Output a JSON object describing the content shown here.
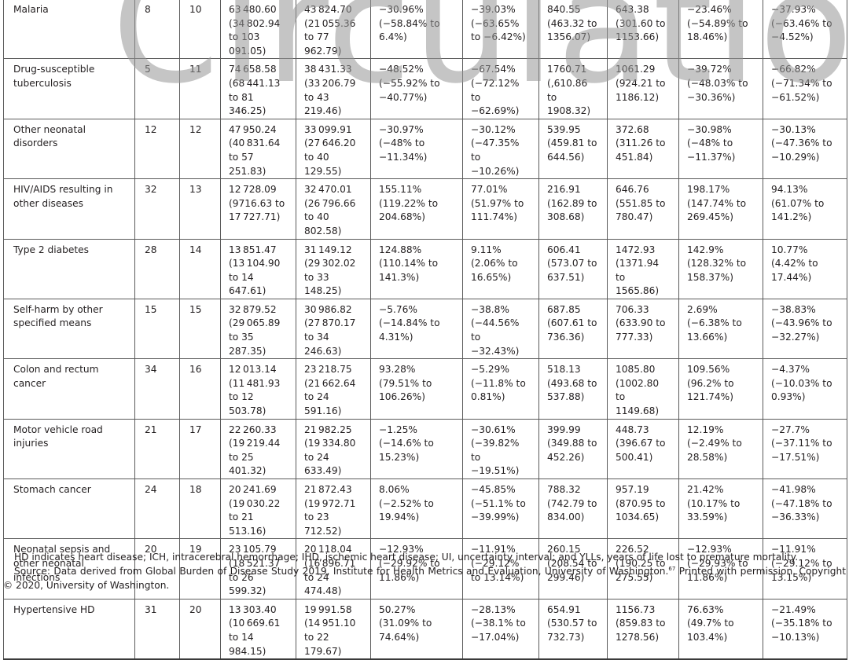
{
  "watermark": "Circulation",
  "table": {
    "rows": [
      {
        "cause": "Malaria",
        "rank_a": "8",
        "rank_b": "10",
        "c1": "63 480.60 (34 802.94 to 103 091.05)",
        "c2": "43 824.70 (21 055.36 to 77 962.79)",
        "c3": "−30.96% (−58.84% to 6.4%)",
        "c4": "−39.03% (−63.65% to −6.42%)",
        "c5": "840.55 (463.32 to 1356.07)",
        "c6": "643.38 (301.60 to 1153.66)",
        "c7": "−23.46% (−54.89% to 18.46%)",
        "c8": "−37.93% (−63.46% to −4.52%)"
      },
      {
        "cause": "Drug-susceptible tuberculosis",
        "rank_a": "5",
        "rank_b": "11",
        "c1": "74 658.58 (68 441.13 to 81 346.25)",
        "c2": "38 431.33 (33 206.79 to 43 219.46)",
        "c3": "−48.52% (−55.92% to −40.77%)",
        "c4": "−67.54% (−72.12% to −62.69%)",
        "c5": "1760.71 (,610.86 to 1908.32)",
        "c6": "1061.29 (924.21 to 1186.12)",
        "c7": "−39.72% (−48.03% to −30.36%)",
        "c8": "−66.82% (−71.34% to −61.52%)"
      },
      {
        "cause": "Other neonatal disorders",
        "rank_a": "12",
        "rank_b": "12",
        "c1": "47 950.24 (40 831.64 to 57 251.83)",
        "c2": "33 099.91 (27 646.20 to 40 129.55)",
        "c3": "−30.97% (−48% to −11.34%)",
        "c4": "−30.12% (−47.35% to −10.26%)",
        "c5": "539.95 (459.81 to 644.56)",
        "c6": "372.68 (311.26 to 451.84)",
        "c7": "−30.98% (−48% to −11.37%)",
        "c8": "−30.13% (−47.36% to −10.29%)"
      },
      {
        "cause": "HIV/AIDS resulting in other diseases",
        "rank_a": "32",
        "rank_b": "13",
        "c1": "12 728.09 (9716.63 to 17 727.71)",
        "c2": "32 470.01 (26 796.66 to 40 802.58)",
        "c3": "155.11% (119.22% to 204.68%)",
        "c4": "77.01% (51.97% to 111.74%)",
        "c5": "216.91 (162.89 to 308.68)",
        "c6": "646.76 (551.85 to 780.47)",
        "c7": "198.17% (147.74% to 269.45%)",
        "c8": "94.13% (61.07% to 141.2%)"
      },
      {
        "cause": "Type 2 diabetes",
        "rank_a": "28",
        "rank_b": "14",
        "c1": "13 851.47 (13 104.90 to 14 647.61)",
        "c2": "31 149.12 (29 302.02 to 33 148.25)",
        "c3": "124.88% (110.14% to 141.3%)",
        "c4": "9.11% (2.06% to 16.65%)",
        "c5": "606.41 (573.07 to 637.51)",
        "c6": "1472.93 (1371.94 to 1565.86)",
        "c7": "142.9% (128.32% to 158.37%)",
        "c8": "10.77% (4.42% to 17.44%)"
      },
      {
        "cause": "Self-harm by other specified means",
        "rank_a": "15",
        "rank_b": "15",
        "c1": "32 879.52 (29 065.89 to 35 287.35)",
        "c2": "30 986.82 (27 870.17 to 34 246.63)",
        "c3": "−5.76% (−14.84% to 4.31%)",
        "c4": "−38.8% (−44.56% to −32.43%)",
        "c5": "687.85 (607.61 to 736.36)",
        "c6": "706.33 (633.90 to 777.33)",
        "c7": "2.69% (−6.38% to 13.66%)",
        "c8": "−38.83% (−43.96% to −32.27%)"
      },
      {
        "cause": "Colon and rectum cancer",
        "rank_a": "34",
        "rank_b": "16",
        "c1": "12 013.14 (11 481.93 to 12 503.78)",
        "c2": "23 218.75 (21 662.64 to 24 591.16)",
        "c3": "93.28% (79.51% to 106.26%)",
        "c4": "−5.29% (−11.8% to 0.81%)",
        "c5": "518.13 (493.68 to 537.88)",
        "c6": "1085.80 (1002.80 to 1149.68)",
        "c7": "109.56% (96.2% to 121.74%)",
        "c8": "−4.37% (−10.03% to 0.93%)"
      },
      {
        "cause": "Motor vehicle road injuries",
        "rank_a": "21",
        "rank_b": "17",
        "c1": "22 260.33 (19 219.44 to 25 401.32)",
        "c2": "21 982.25 (19 334.80 to 24 633.49)",
        "c3": "−1.25% (−14.6% to 15.23%)",
        "c4": "−30.61% (−39.82% to −19.51%)",
        "c5": "399.99 (349.88 to 452.26)",
        "c6": "448.73 (396.67 to 500.41)",
        "c7": "12.19% (−2.49% to 28.58%)",
        "c8": "−27.7% (−37.11% to −17.51%)"
      },
      {
        "cause": "Stomach cancer",
        "rank_a": "24",
        "rank_b": "18",
        "c1": "20 241.69 (19 030.22 to 21 513.16)",
        "c2": "21 872.43 (19 972.71 to 23 712.52)",
        "c3": "8.06% (−2.52% to 19.94%)",
        "c4": "−45.85% (−51.1% to −39.99%)",
        "c5": "788.32 (742.79 to 834.00)",
        "c6": "957.19 (870.95 to 1034.65)",
        "c7": "21.42% (10.17% to 33.59%)",
        "c8": "−41.98% (−47.18% to −36.33%)"
      },
      {
        "cause": "Neonatal sepsis and other neonatal infections",
        "rank_a": "20",
        "rank_b": "19",
        "c1": "23 105.79 (18 521.37 to 26 599.32)",
        "c2": "20 118.04 (16 896.71 to 24 474.48)",
        "c3": "−12.93% (−29.92% to 11.86%)",
        "c4": "−11.91% (−29.12% to 13.14%)",
        "c5": "260.15 (208.54 to 299.46)",
        "c6": "226.52 (190.25 to 275.55)",
        "c7": "−12.93% (−29.93% to 11.86%)",
        "c8": "−11.91% (−29.12% to 13.15%)"
      },
      {
        "cause": "Hypertensive HD",
        "rank_a": "31",
        "rank_b": "20",
        "c1": "13 303.40 (10 669.61 to 14 984.15)",
        "c2": "19 991.58 (14 951.10 to 22 179.67)",
        "c3": "50.27% (31.09% to 74.64%)",
        "c4": "−28.13% (−38.1% to −17.04%)",
        "c5": "654.91 (530.57 to 732.73)",
        "c6": "1156.73 (859.83 to 1278.56)",
        "c7": "76.63% (49.7% to 103.4%)",
        "c8": "−21.49% (−35.18% to −10.13%)"
      }
    ]
  },
  "footnotes": {
    "abbreviations": "HD indicates heart disease; ICH, intracerebral hemorrhage; IHD, ischemic heart disease; UI, uncertainty interval; and YLLs, years of life lost to premature mortality.",
    "source_prefix": "Source: Data derived from Global Burden of Disease Study 2019, Institute for Health Metrics and Evaluation, University of Washington.",
    "source_ref": "67",
    "source_suffix": " Printed with permission. Copyright © 2020, University of Washington."
  }
}
